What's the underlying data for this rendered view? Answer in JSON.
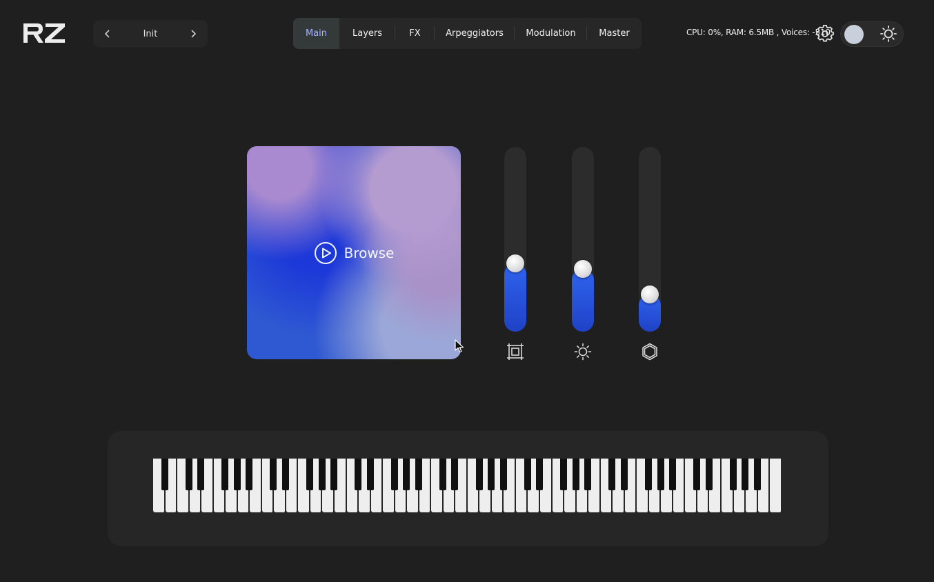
{
  "app": {
    "logo_text": "RZ",
    "colors": {
      "background": "#1f1f1f",
      "accent": "#2f63ee",
      "active_tab_text": "#a9b4ff"
    }
  },
  "preset": {
    "name": "Init",
    "prev_icon": "chevron-left-icon",
    "next_icon": "chevron-right-icon"
  },
  "tabs": [
    {
      "label": "Main",
      "active": true
    },
    {
      "label": "Layers",
      "active": false
    },
    {
      "label": "FX",
      "active": false
    },
    {
      "label": "Arpeggiators",
      "active": false
    },
    {
      "label": "Modulation",
      "active": false
    },
    {
      "label": "Master",
      "active": false
    }
  ],
  "status": {
    "text": "CPU: 0%, RAM: 6.5MB , Voices: -510"
  },
  "header_icons": {
    "settings": "gear-icon",
    "theme": "sun-icon"
  },
  "browse": {
    "label": "Browse",
    "icon": "play-circle-icon"
  },
  "sliders": [
    {
      "name": "frame",
      "level": 0.37,
      "icon": "frame-icon"
    },
    {
      "name": "brightness",
      "level": 0.34,
      "icon": "sun-icon"
    },
    {
      "name": "shape",
      "level": 0.2,
      "icon": "hexagon-icon"
    }
  ],
  "keyboard": {
    "octaves": 7,
    "white_keys": 52
  }
}
